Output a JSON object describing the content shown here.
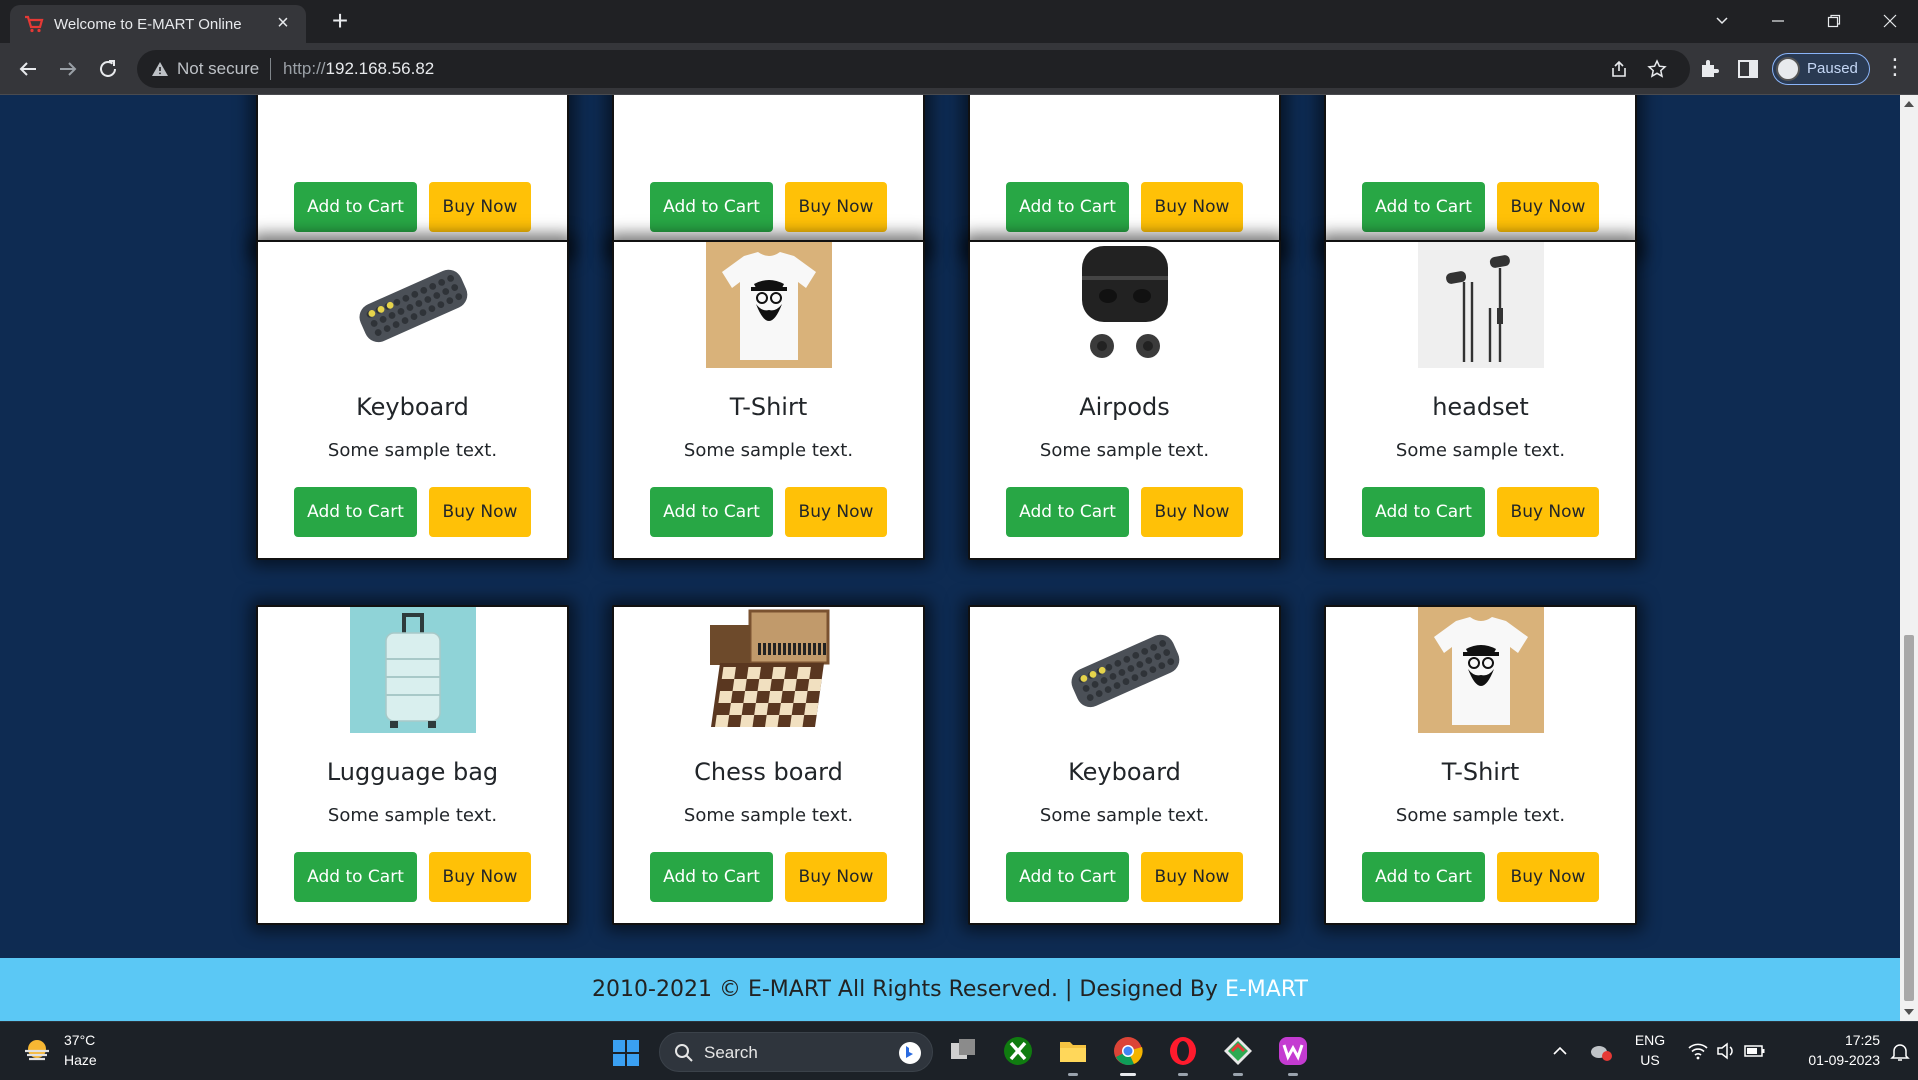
{
  "browser": {
    "tab_title": "Welcome to E-MART Online",
    "new_tab_label": "+",
    "security_label": "Not secure",
    "url_scheme": "http://",
    "url_host": "192.168.56.82",
    "profile_status": "Paused"
  },
  "products": [
    {
      "name": "",
      "text": "",
      "cart_label": "Add to Cart",
      "buy_label": "Buy Now",
      "image": "hidden"
    },
    {
      "name": "",
      "text": "",
      "cart_label": "Add to Cart",
      "buy_label": "Buy Now",
      "image": "hidden"
    },
    {
      "name": "",
      "text": "",
      "cart_label": "Add to Cart",
      "buy_label": "Buy Now",
      "image": "hidden"
    },
    {
      "name": "",
      "text": "",
      "cart_label": "Add to Cart",
      "buy_label": "Buy Now",
      "image": "hidden"
    },
    {
      "name": "Keyboard",
      "text": "Some sample text.",
      "cart_label": "Add to Cart",
      "buy_label": "Buy Now",
      "image": "keyboard"
    },
    {
      "name": "T-Shirt",
      "text": "Some sample text.",
      "cart_label": "Add to Cart",
      "buy_label": "Buy Now",
      "image": "tshirt"
    },
    {
      "name": "Airpods",
      "text": "Some sample text.",
      "cart_label": "Add to Cart",
      "buy_label": "Buy Now",
      "image": "airpods"
    },
    {
      "name": "headset",
      "text": "Some sample text.",
      "cart_label": "Add to Cart",
      "buy_label": "Buy Now",
      "image": "earphones"
    },
    {
      "name": "Lugguage bag",
      "text": "Some sample text.",
      "cart_label": "Add to Cart",
      "buy_label": "Buy Now",
      "image": "luggage"
    },
    {
      "name": "Chess board",
      "text": "Some sample text.",
      "cart_label": "Add to Cart",
      "buy_label": "Buy Now",
      "image": "chess"
    },
    {
      "name": "Keyboard",
      "text": "Some sample text.",
      "cart_label": "Add to Cart",
      "buy_label": "Buy Now",
      "image": "keyboard"
    },
    {
      "name": "T-Shirt",
      "text": "Some sample text.",
      "cart_label": "Add to Cart",
      "buy_label": "Buy Now",
      "image": "tshirt"
    }
  ],
  "footer": {
    "text": "2010-2021 © E-MART All Rights Reserved. | Designed By",
    "brand": "E-MART"
  },
  "taskbar": {
    "weather_temp": "37°C",
    "weather_desc": "Haze",
    "search_label": "Search",
    "language": "ENG",
    "region": "US",
    "time": "17:25",
    "date": "01-09-2023"
  },
  "colors": {
    "page_background": "#0e2b52",
    "add_to_cart": "#28a745",
    "buy_now": "#ffc107",
    "footer": "#5bc8f5"
  }
}
